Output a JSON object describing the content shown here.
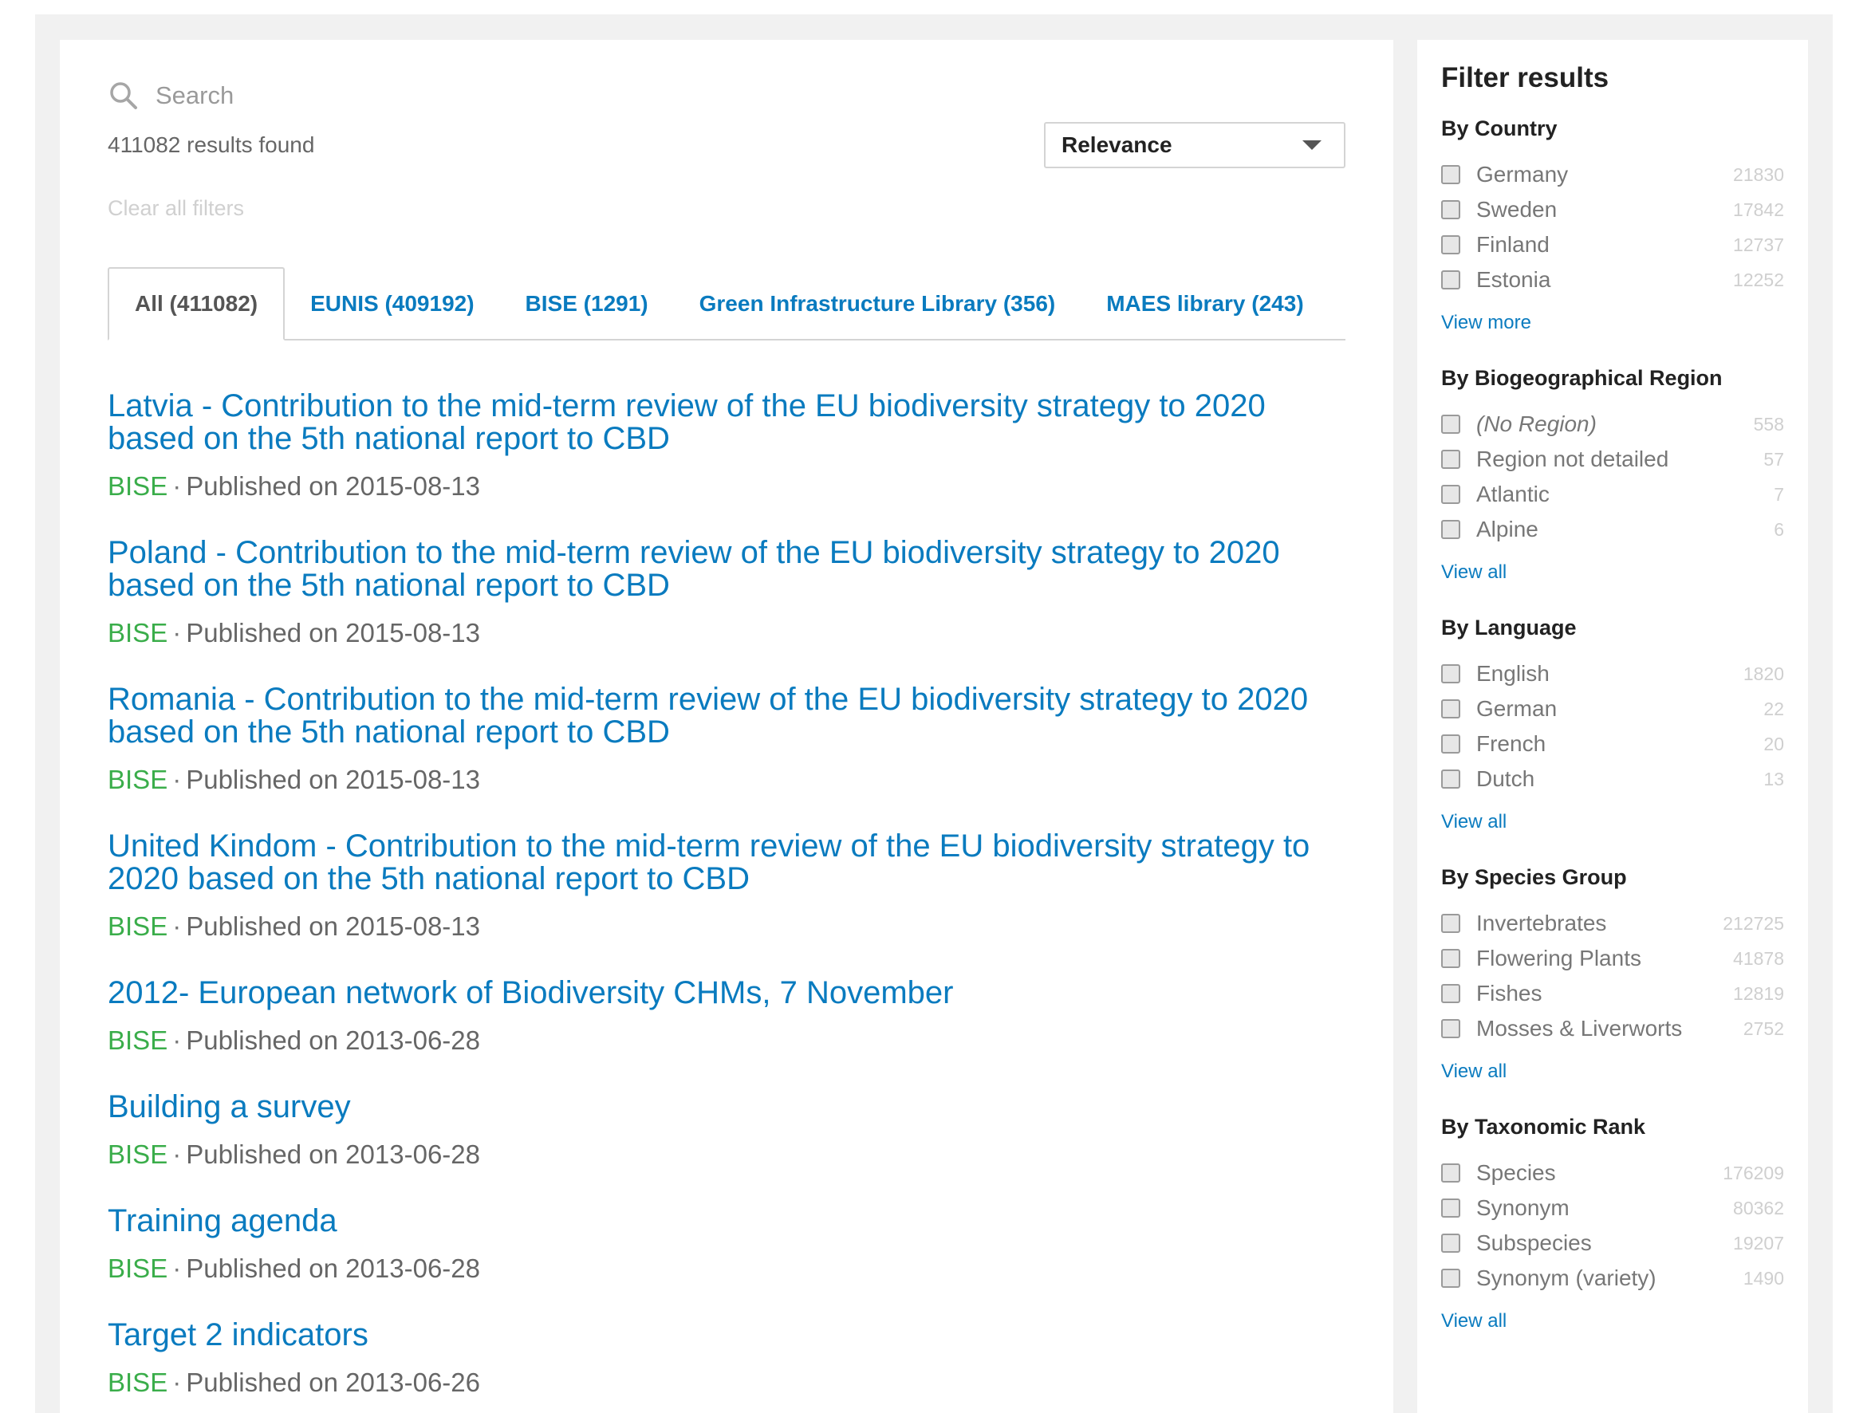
{
  "search": {
    "placeholder": "Search"
  },
  "results_info": {
    "count_text": "411082 results found"
  },
  "sort": {
    "selected": "Relevance"
  },
  "clear_filters": "Clear all filters",
  "tabs": [
    {
      "label": "All (411082)",
      "active": true
    },
    {
      "label": "EUNIS (409192)",
      "active": false
    },
    {
      "label": "BISE (1291)",
      "active": false
    },
    {
      "label": "Green Infrastructure Library (356)",
      "active": false
    },
    {
      "label": "MAES library (243)",
      "active": false
    }
  ],
  "results": [
    {
      "title_line1": "Latvia - Contribution to the mid-term review of the EU biodiversity strategy to 2020",
      "title_line2": "based on the 5th national report to CBD",
      "source": "BISE",
      "published": "Published on 2015-08-13"
    },
    {
      "title_line1": "Poland - Contribution to the mid-term review of the EU biodiversity strategy to 2020",
      "title_line2": "based on the 5th national report to CBD",
      "source": "BISE",
      "published": "Published on 2015-08-13"
    },
    {
      "title_line1": "Romania - Contribution to the mid-term review of the EU biodiversity strategy to 2020",
      "title_line2": "based on the 5th national report to CBD",
      "source": "BISE",
      "published": "Published on 2015-08-13"
    },
    {
      "title_line1": "United Kindom - Contribution to the mid-term review of the EU biodiversity strategy to",
      "title_line2": "2020 based on the 5th national report to CBD",
      "source": "BISE",
      "published": "Published on 2015-08-13"
    },
    {
      "title_line1": "2012- European network of Biodiversity CHMs, 7 November",
      "title_line2": "",
      "source": "BISE",
      "published": "Published on 2013-06-28"
    },
    {
      "title_line1": "Building a survey",
      "title_line2": "",
      "source": "BISE",
      "published": "Published on 2013-06-28"
    },
    {
      "title_line1": "Training agenda",
      "title_line2": "",
      "source": "BISE",
      "published": "Published on 2013-06-28"
    },
    {
      "title_line1": "Target 2 indicators",
      "title_line2": "",
      "source": "BISE",
      "published": "Published on 2013-06-26"
    }
  ],
  "sidebar": {
    "heading": "Filter results",
    "facets": [
      {
        "title": "By Country",
        "more": "View more",
        "options": [
          {
            "label": "Germany",
            "count": "21830"
          },
          {
            "label": "Sweden",
            "count": "17842"
          },
          {
            "label": "Finland",
            "count": "12737"
          },
          {
            "label": "Estonia",
            "count": "12252"
          }
        ]
      },
      {
        "title": "By Biogeographical Region",
        "more": "View all",
        "options": [
          {
            "label": "(No Region)",
            "count": "558",
            "italic": true
          },
          {
            "label": "Region not detailed",
            "count": "57"
          },
          {
            "label": "Atlantic",
            "count": "7"
          },
          {
            "label": "Alpine",
            "count": "6"
          }
        ]
      },
      {
        "title": "By Language",
        "more": "View all",
        "options": [
          {
            "label": "English",
            "count": "1820"
          },
          {
            "label": "German",
            "count": "22"
          },
          {
            "label": "French",
            "count": "20"
          },
          {
            "label": "Dutch",
            "count": "13"
          }
        ]
      },
      {
        "title": "By Species Group",
        "more": "View all",
        "options": [
          {
            "label": "Invertebrates",
            "count": "212725"
          },
          {
            "label": "Flowering Plants",
            "count": "41878"
          },
          {
            "label": "Fishes",
            "count": "12819"
          },
          {
            "label": "Mosses & Liverworts",
            "count": "2752"
          }
        ]
      },
      {
        "title": "By Taxonomic Rank",
        "more": "View all",
        "options": [
          {
            "label": "Species",
            "count": "176209"
          },
          {
            "label": "Synonym",
            "count": "80362"
          },
          {
            "label": "Subspecies",
            "count": "19207"
          },
          {
            "label": "Synonym (variety)",
            "count": "1490"
          }
        ]
      }
    ]
  }
}
